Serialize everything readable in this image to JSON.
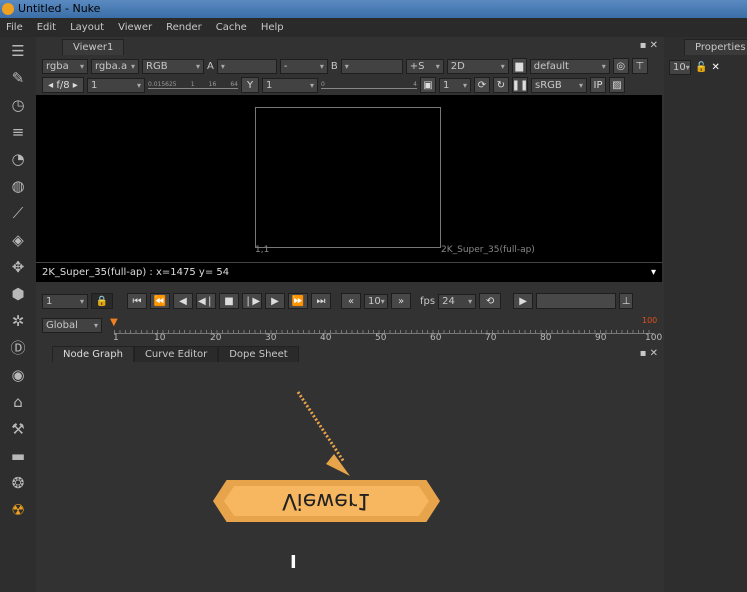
{
  "window": {
    "title": "Untitled - Nuke"
  },
  "menu": [
    "File",
    "Edit",
    "Layout",
    "Viewer",
    "Render",
    "Cache",
    "Help"
  ],
  "toolbar_icons": [
    "input-icon",
    "paint-icon",
    "time-icon",
    "channel-icon",
    "color-icon",
    "filter-icon",
    "keyer-icon",
    "merge-icon",
    "transform-icon",
    "3d-icon",
    "particles-icon",
    "deep-icon",
    "views-icon",
    "metadata-icon",
    "toolsets-icon",
    "other-icon",
    "furnace-icon",
    "nuke-icon"
  ],
  "viewer": {
    "tab": "Viewer1",
    "row1": {
      "channels": "rgba",
      "alpha": "rgba.a",
      "display": "RGB",
      "a_label": "A",
      "a_input": "",
      "op": "-",
      "b_label": "B",
      "b_input": "",
      "zoom": "+S",
      "mode": "2D",
      "lut": "default"
    },
    "row2": {
      "fstop": "f/8",
      "gain": "1",
      "gain_ticks": [
        "0.015625",
        "1",
        "16",
        "64"
      ],
      "y": "Y",
      "gamma": "1",
      "gamma_ticks": [
        "0",
        "4"
      ],
      "proxy": "1",
      "colorspace": "sRGB",
      "ip": "IP"
    },
    "format_left": "1,1",
    "format_right": "2K_Super_35(full-ap)",
    "info": "2K_Super_35(full-ap) : x=1475 y= 54"
  },
  "playback": {
    "frame": "1",
    "increment": "10",
    "fps_label": "fps",
    "fps": "24"
  },
  "timeline": {
    "scope": "Global",
    "start": "1",
    "end": "100",
    "ticks": [
      "1",
      "10",
      "20",
      "30",
      "40",
      "50",
      "60",
      "70",
      "80",
      "90",
      "100"
    ],
    "current_frame": 1
  },
  "panels": {
    "tabs": [
      "Node Graph",
      "Curve Editor",
      "Dope Sheet"
    ],
    "active": "Node Graph"
  },
  "node": {
    "label": "Viewer1",
    "color": "#f6b760"
  },
  "properties": {
    "tab": "Properties",
    "max_panels": "10"
  }
}
